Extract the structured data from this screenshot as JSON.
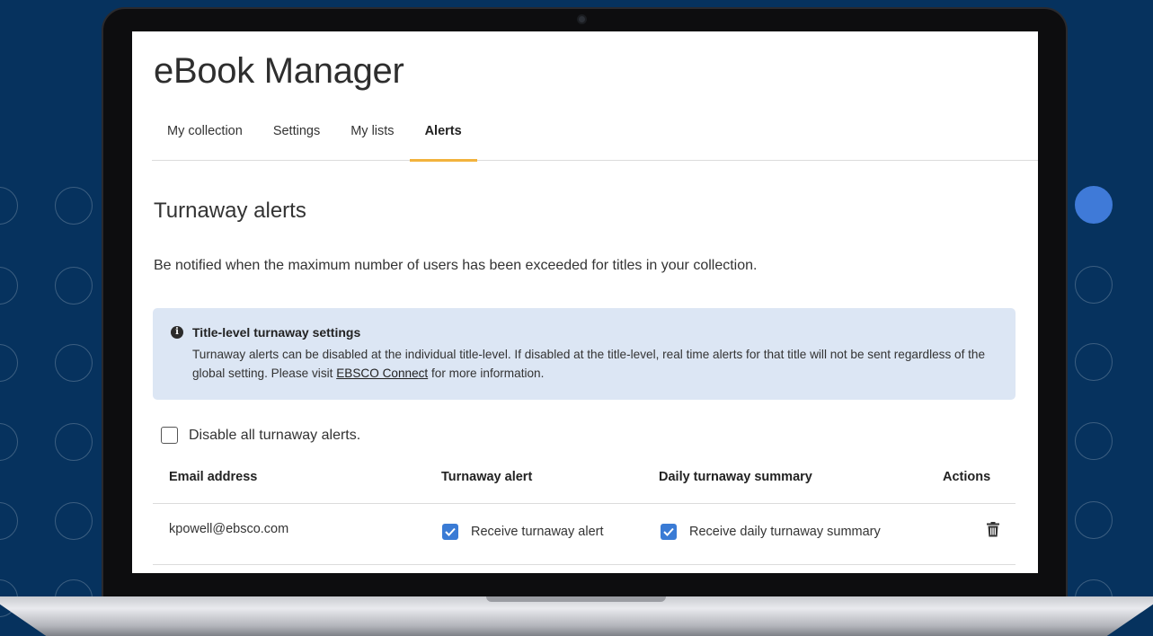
{
  "app": {
    "title": "eBook Manager"
  },
  "tabs": [
    {
      "label": "My collection",
      "active": false
    },
    {
      "label": "Settings",
      "active": false
    },
    {
      "label": "My lists",
      "active": false
    },
    {
      "label": "Alerts",
      "active": true
    }
  ],
  "section": {
    "title": "Turnaway alerts",
    "description": "Be notified when the maximum number of users has been exceeded for titles in your collection."
  },
  "info_box": {
    "icon": "info-icon",
    "heading": "Title-level turnaway settings",
    "text_before_link": "Turnaway alerts can be disabled at the individual title-level. If disabled at the title-level, real time alerts for that title will not be sent regardless of the global setting. Please visit ",
    "link_text": "EBSCO Connect",
    "text_after_link": " for more information."
  },
  "disable_all": {
    "label": "Disable all turnaway alerts.",
    "checked": false
  },
  "table": {
    "headers": [
      "Email address",
      "Turnaway alert",
      "Daily turnaway summary",
      "Actions"
    ],
    "rows": [
      {
        "email": "kpowell@ebsco.com",
        "turnaway_alert": {
          "label": "Receive turnaway alert",
          "checked": true
        },
        "daily_summary": {
          "label": "Receive daily turnaway summary",
          "checked": true
        },
        "action_icon": "trash-icon"
      }
    ]
  },
  "colors": {
    "background": "#06325e",
    "tab_active_underline": "#f2b33d",
    "info_box_bg": "#dce6f4",
    "checkbox_checked": "#3a7bd5",
    "accent_dot": "#3f7ad8"
  }
}
